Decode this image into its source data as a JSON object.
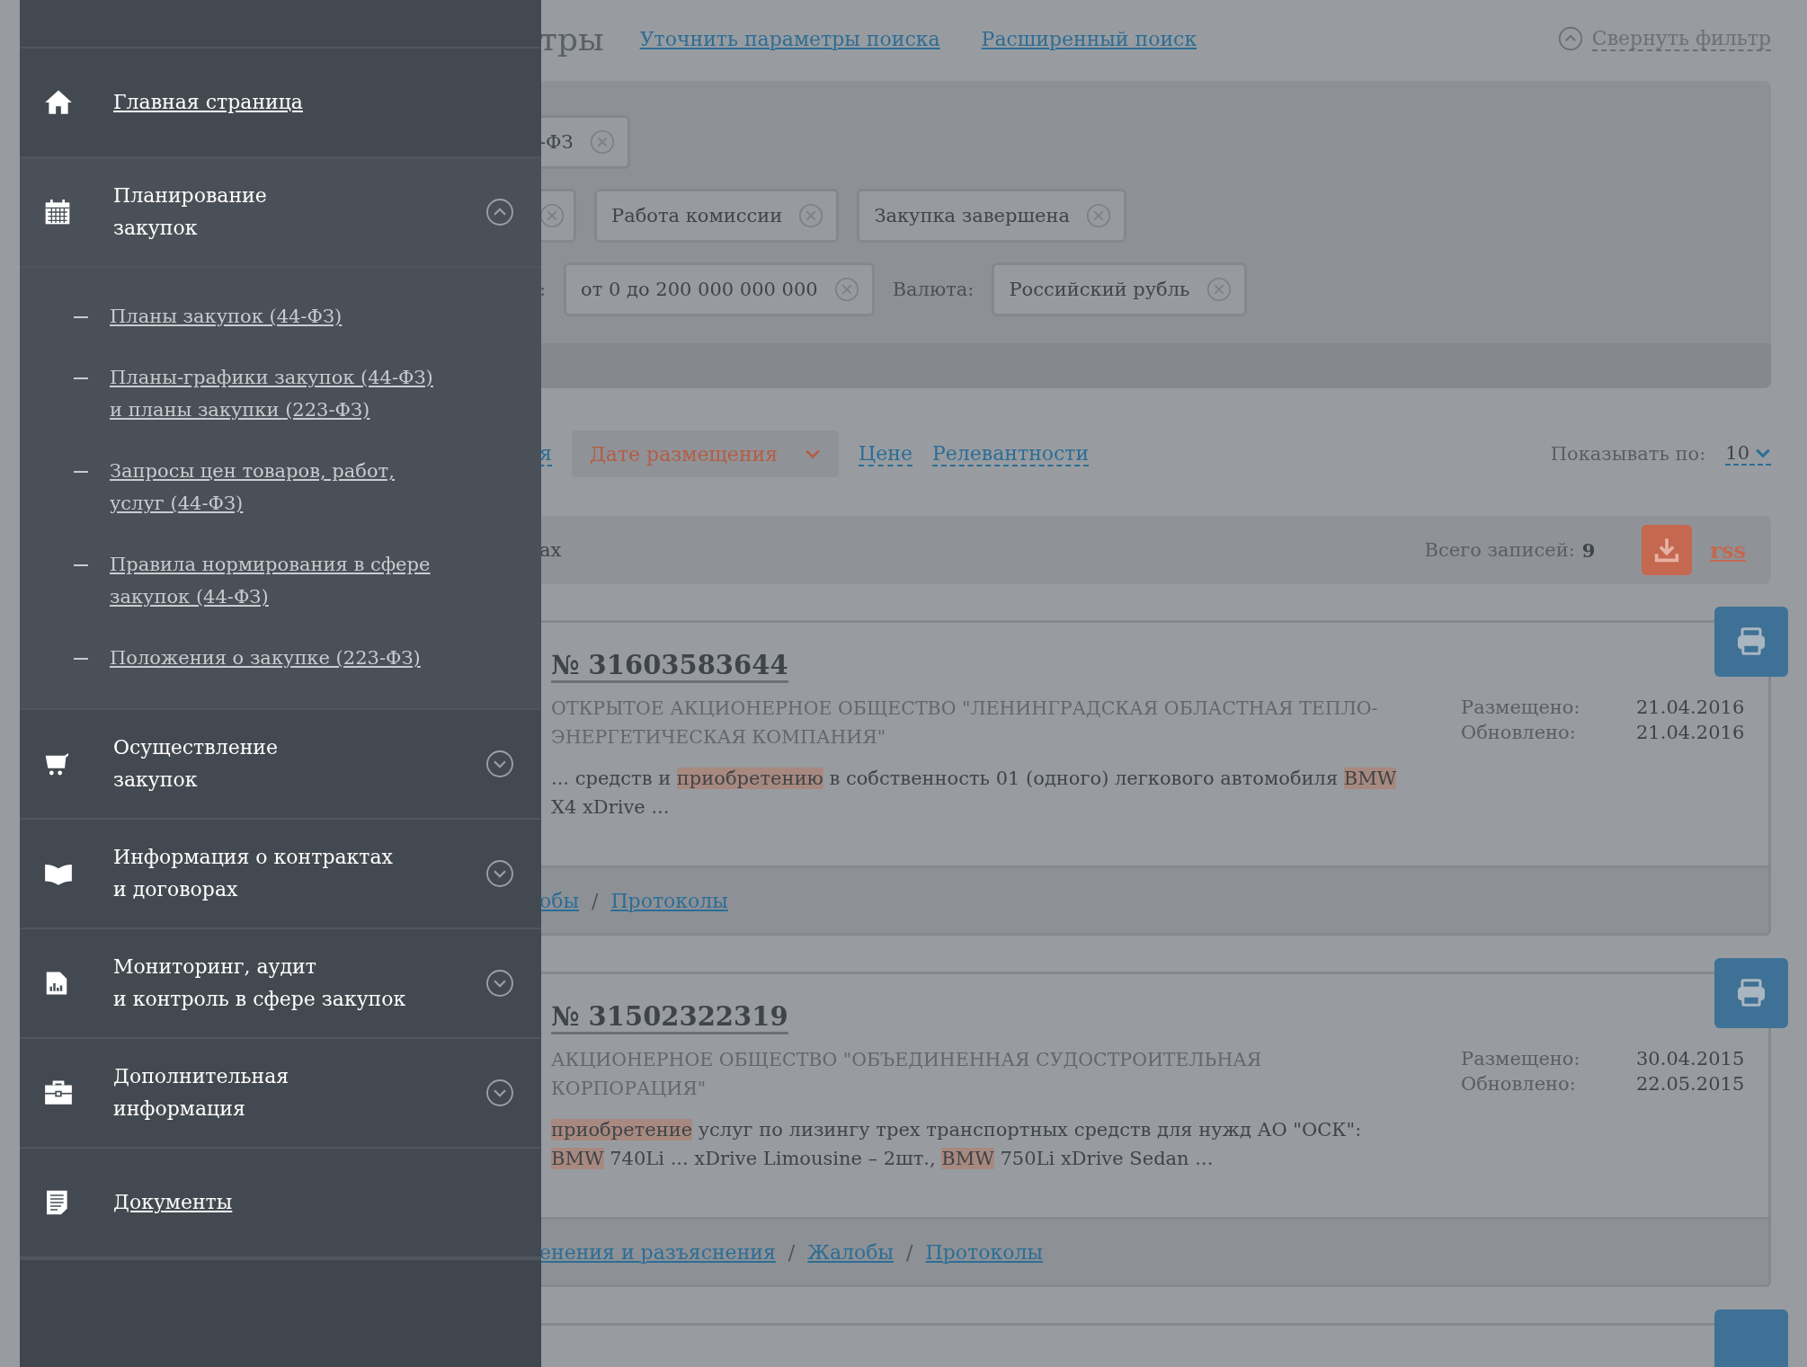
{
  "menu": {
    "items": [
      {
        "kind": "link",
        "lines": [
          "Главная страница"
        ]
      },
      {
        "kind": "section",
        "lines": [
          "Планирование",
          "закупок"
        ],
        "expanded": true,
        "children": [
          {
            "lines": [
              "Планы закупок (44-ФЗ)"
            ]
          },
          {
            "lines": [
              "Планы-графики закупок (44-ФЗ)",
              "и планы закупки (223-ФЗ)"
            ]
          },
          {
            "lines": [
              "Запросы цен товаров, работ,",
              "услуг (44-ФЗ)"
            ]
          },
          {
            "lines": [
              "Правила нормирования в сфере",
              "закупок (44-ФЗ)"
            ]
          },
          {
            "lines": [
              "Положения о закупке (223-ФЗ)"
            ]
          }
        ]
      },
      {
        "kind": "section",
        "lines": [
          "Осуществление",
          "закупок"
        ],
        "expanded": false
      },
      {
        "kind": "section",
        "lines": [
          "Информация о контрактах",
          "и договорах"
        ],
        "expanded": false
      },
      {
        "kind": "section",
        "lines": [
          "Мониторинг, аудит",
          "и контроль в сфере закупок"
        ],
        "expanded": false
      },
      {
        "kind": "section",
        "lines": [
          "Дополнительная",
          "информация"
        ],
        "expanded": false
      },
      {
        "kind": "link",
        "lines": [
          "Документы"
        ]
      }
    ]
  },
  "header": {
    "title": "тры",
    "links": [
      "Уточнить параметры поиска",
      "Расширенный поиск"
    ],
    "collapse": "Свернуть фильтр"
  },
  "filters": {
    "rows": [
      [
        {
          "kind": "chip",
          "text": "-ФЗ"
        }
      ],
      [
        {
          "kind": "stub"
        },
        {
          "kind": "chip",
          "text": "Работа комиссии"
        },
        {
          "kind": "chip",
          "text": "Закупка завершена"
        }
      ],
      [
        {
          "kind": "label",
          "text": ":"
        },
        {
          "kind": "chip",
          "text": "от 0 до 200 000 000 000"
        },
        {
          "kind": "label",
          "text": "Валюта:"
        },
        {
          "kind": "chip",
          "text": "Российский рубль"
        }
      ]
    ]
  },
  "sort": {
    "options": [
      {
        "text": "я",
        "selected": false
      },
      {
        "text": "Дате размещения",
        "selected": true
      },
      {
        "text": "Цене",
        "selected": false
      },
      {
        "text": "Релевантности",
        "selected": false
      }
    ],
    "page_size_label": "Показывать по:",
    "page_size": "10"
  },
  "summary": {
    "text": "ах",
    "total_label": "Всего записей:",
    "total": "9",
    "rss": "rss"
  },
  "records": [
    {
      "number": "№ 31603583644",
      "org": "ОТКРЫТОЕ АКЦИОНЕРНОЕ ОБЩЕСТВО \"ЛЕНИНГРАДСКАЯ ОБЛАСТНАЯ ТЕПЛО-ЭНЕРГЕТИЧЕСКАЯ КОМПАНИЯ\"",
      "snippet": [
        {
          "text": "... средств и ",
          "highlight": false
        },
        {
          "text": "приобретению",
          "highlight": true
        },
        {
          "text": " в собственность 01 (одного) легкового автомобиля ",
          "highlight": false
        },
        {
          "text": "BMW",
          "highlight": true
        },
        {
          "text": " X4 xDrive ...",
          "highlight": false
        }
      ],
      "dates": [
        {
          "label": "Размещено:",
          "value": "21.04.2016"
        },
        {
          "label": "Обновлено:",
          "value": "21.04.2016"
        }
      ],
      "links": [
        "обы",
        "Протоколы"
      ]
    },
    {
      "number": "№ 31502322319",
      "org": "АКЦИОНЕРНОЕ ОБЩЕСТВО \"ОБЪЕДИНЕННАЯ СУДОСТРОИТЕЛЬНАЯ КОРПОРАЦИЯ\"",
      "snippet": [
        {
          "text": "приобретение",
          "highlight": true
        },
        {
          "text": " услуг по лизингу трех транспортных средств для нужд АО \"ОСК\": ",
          "highlight": false
        },
        {
          "text": "BMW",
          "highlight": true
        },
        {
          "text": " 740Li ... xDrive Limousine – 2шт., ",
          "highlight": false
        },
        {
          "text": "BMW",
          "highlight": true
        },
        {
          "text": " 750Li xDrive Sedan ...",
          "highlight": false
        }
      ],
      "dates": [
        {
          "label": "Размещено:",
          "value": "30.04.2015"
        },
        {
          "label": "Обновлено:",
          "value": "22.05.2015"
        }
      ],
      "links": [
        "енения и разъяснения",
        "Жалобы",
        "Протоколы"
      ]
    }
  ],
  "link_separator": "/"
}
